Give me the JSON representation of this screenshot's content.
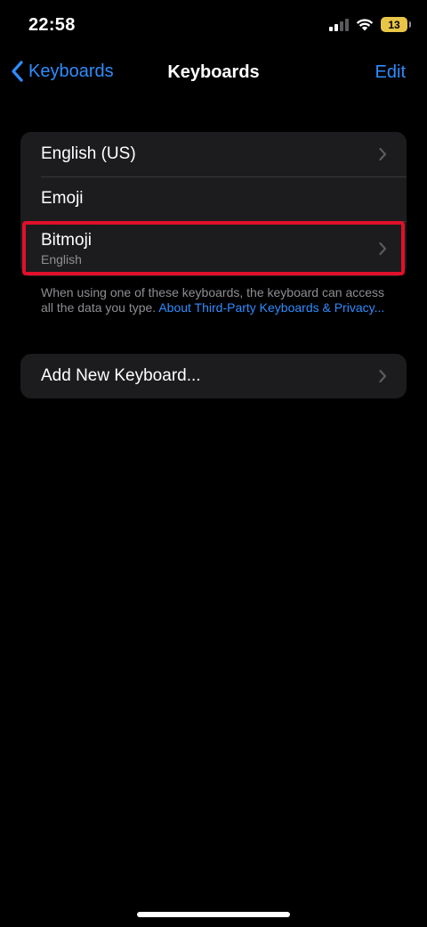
{
  "status": {
    "time": "22:58",
    "battery": "13"
  },
  "nav": {
    "back_label": "Keyboards",
    "title": "Keyboards",
    "edit_label": "Edit"
  },
  "keyboards": [
    {
      "label": "English (US)"
    },
    {
      "label": "Emoji"
    },
    {
      "label": "Bitmoji",
      "sublabel": "English"
    }
  ],
  "footer": {
    "text": "When using one of these keyboards, the keyboard can access all the data you type. ",
    "link": "About Third-Party Keyboards & Privacy..."
  },
  "add_keyboard": {
    "label": "Add New Keyboard..."
  },
  "colors": {
    "accent": "#2f8cff",
    "highlight": "#e0102a",
    "battery": "#e8c547"
  }
}
